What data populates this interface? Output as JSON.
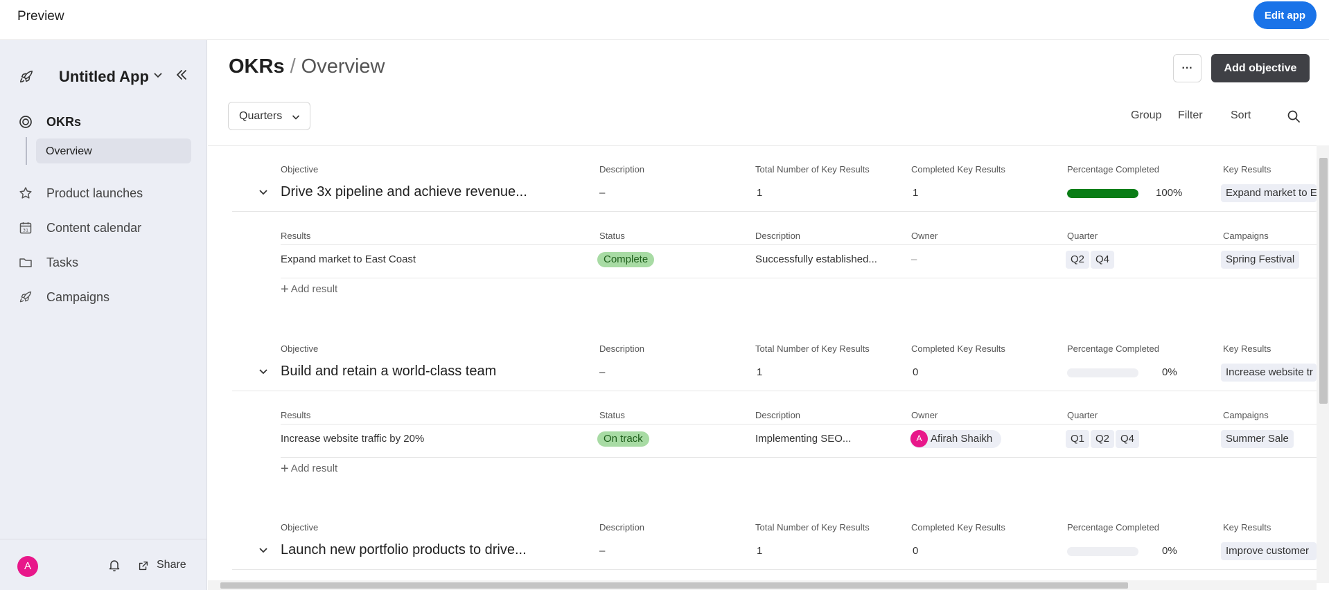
{
  "topbar": {
    "title": "Preview",
    "edit_label": "Edit app"
  },
  "sidebar": {
    "app_name": "Untitled App",
    "items": [
      {
        "label": "OKRs",
        "icon": "target-icon",
        "active": true
      },
      {
        "label": "Product launches",
        "icon": "star-icon"
      },
      {
        "label": "Content calendar",
        "icon": "calendar-icon"
      },
      {
        "label": "Tasks",
        "icon": "folder-icon"
      },
      {
        "label": "Campaigns",
        "icon": "rocket-icon"
      }
    ],
    "subitem": "Overview",
    "calendar_day": "31",
    "avatar_initial": "A",
    "share_label": "Share"
  },
  "main": {
    "title": "OKRs",
    "separator": "/",
    "subtitle": "Overview",
    "more_label": "···",
    "add_objective_label": "Add objective",
    "quarters_label": "Quarters",
    "tools": {
      "group": "Group",
      "filter": "Filter",
      "sort": "Sort"
    }
  },
  "headers": {
    "objective": "Objective",
    "description": "Description",
    "total": "Total Number of Key Results",
    "completed": "Completed Key Results",
    "percentage": "Percentage Completed",
    "key_results": "Key Results",
    "results": "Results",
    "status": "Status",
    "owner": "Owner",
    "quarter": "Quarter",
    "campaigns": "Campaigns"
  },
  "add_result_label": "Add result",
  "objectives": [
    {
      "title": "Drive 3x pipeline and achieve revenue...",
      "description": "–",
      "total": "1",
      "completed": "1",
      "percent": "100%",
      "progress": 1.0,
      "key_result": "Expand market to E",
      "result": {
        "name": "Expand market to East Coast",
        "status": "Complete",
        "description": "Successfully established...",
        "owner": "–",
        "quarters": [
          "Q2",
          "Q4"
        ],
        "campaign": "Spring Festival"
      }
    },
    {
      "title": "Build and retain a world-class team",
      "description": "–",
      "total": "1",
      "completed": "0",
      "percent": "0%",
      "progress": 0,
      "key_result": "Increase website tr",
      "result": {
        "name": "Increase website traffic by 20%",
        "status": "On track",
        "description": "Implementing SEO...",
        "owner": "Afirah Shaikh",
        "owner_initial": "A",
        "quarters": [
          "Q1",
          "Q2",
          "Q4"
        ],
        "campaign": "Summer Sale"
      }
    },
    {
      "title": "Launch new portfolio products to drive...",
      "description": "–",
      "total": "1",
      "completed": "0",
      "percent": "0%",
      "progress": 0,
      "key_result": "Improve customer"
    }
  ]
}
